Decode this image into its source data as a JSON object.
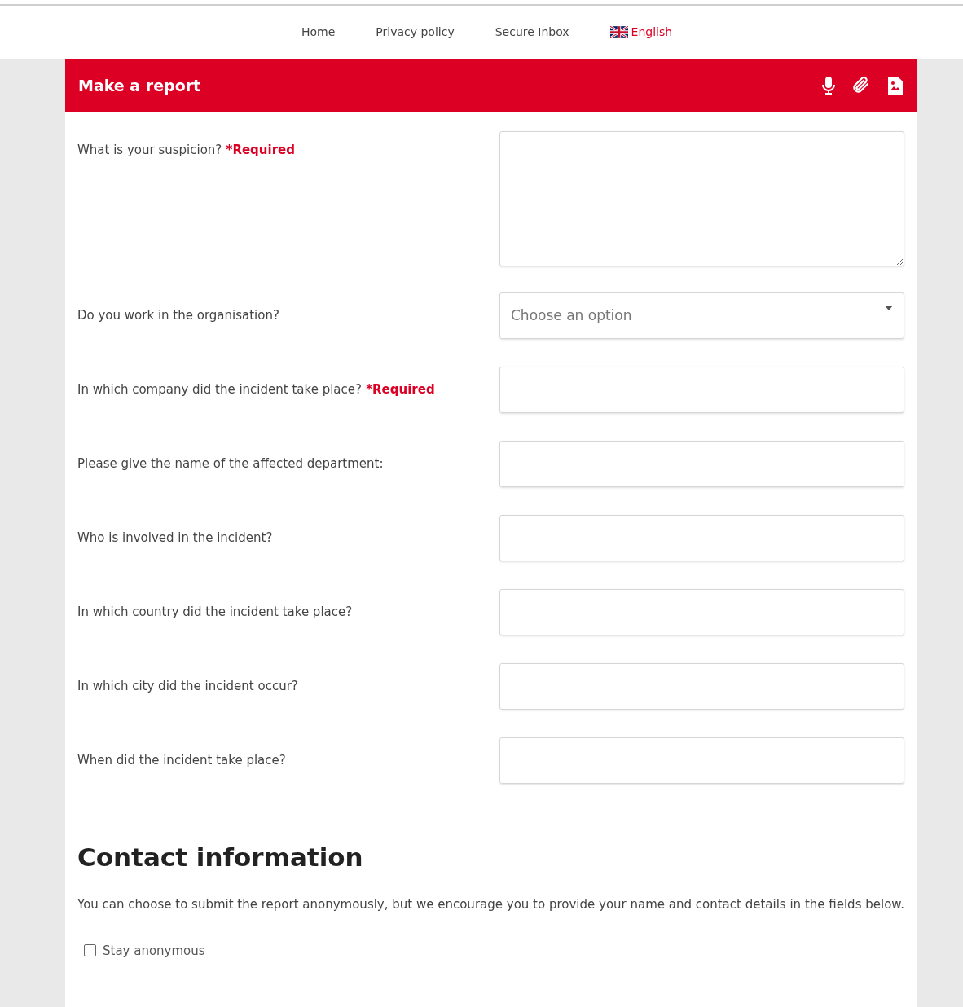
{
  "nav": [
    {
      "label": "Home",
      "kind": "link"
    },
    {
      "label": "Privacy policy",
      "kind": "link"
    },
    {
      "label": "Secure Inbox",
      "kind": "link"
    },
    {
      "label": "English",
      "kind": "language"
    }
  ],
  "header": {
    "title": "Make a report"
  },
  "fields": [
    {
      "kind": "textarea",
      "label": "What is your suspicion?",
      "required_note": "*Required"
    },
    {
      "kind": "select",
      "label": "Do you work in the organisation?",
      "placeholder": "Choose an option"
    },
    {
      "kind": "text",
      "label": "In which company did the incident take place?",
      "required_note": "*Required"
    },
    {
      "kind": "text",
      "label": "Please give the name of the affected department:"
    },
    {
      "kind": "text",
      "label": "Who is involved in the incident?"
    },
    {
      "kind": "text",
      "label": "In which country did the incident take place?"
    },
    {
      "kind": "text",
      "label": "In which city did the incident occur?"
    },
    {
      "kind": "text",
      "label": "When did the incident take place?"
    }
  ],
  "contact": {
    "heading": "Contact information",
    "intro": "You can choose to submit the report anonymously, but we encourage you to provide your name and contact details in the fields below.",
    "anonymous": {
      "label": "Stay anonymous",
      "checked": false
    }
  }
}
